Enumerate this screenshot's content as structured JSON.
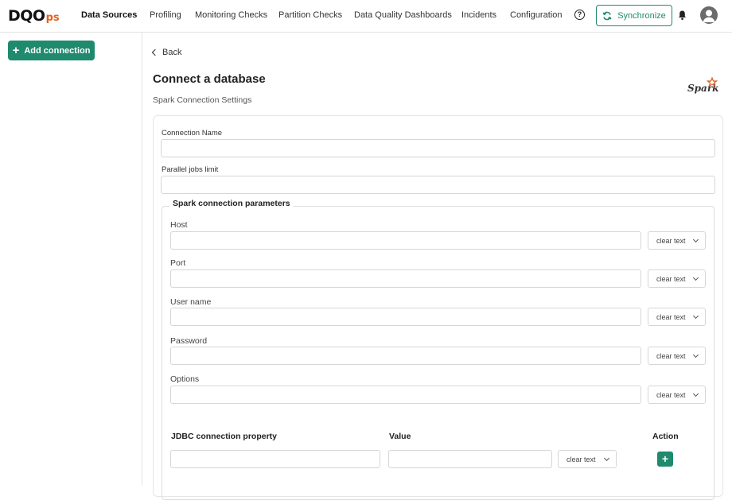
{
  "logo": {
    "main": "DQO",
    "suffix": "ps"
  },
  "nav": {
    "items": [
      "Data Sources",
      "Profiling",
      "Monitoring Checks",
      "Partition Checks",
      "Data Quality Dashboards",
      "Incidents",
      "Configuration"
    ],
    "help": "?",
    "sync_label": "Synchronize"
  },
  "sidebar": {
    "add_connection_label": "Add connection",
    "plus": "+"
  },
  "main": {
    "back_label": "Back",
    "title": "Connect a database",
    "subtitle": "Spark Connection Settings",
    "fields": {
      "connection_name_label": "Connection Name",
      "connection_name_value": "",
      "parallel_jobs_label": "Parallel jobs limit",
      "parallel_jobs_value": ""
    },
    "spark": {
      "legend": "Spark connection parameters",
      "params": [
        {
          "label": "Host",
          "value": "",
          "mode": "clear text"
        },
        {
          "label": "Port",
          "value": "",
          "mode": "clear text"
        },
        {
          "label": "User name",
          "value": "",
          "mode": "clear text"
        },
        {
          "label": "Password",
          "value": "",
          "mode": "clear text"
        },
        {
          "label": "Options",
          "value": "",
          "mode": "clear text"
        }
      ],
      "jdbc": {
        "headers": [
          "JDBC connection property",
          "Value",
          "Action"
        ],
        "row": {
          "property": "",
          "value": "",
          "mode": "clear text"
        },
        "add": "+"
      }
    }
  },
  "colors": {
    "accent": "#1f8a6e",
    "logo_accent": "#e8601c",
    "spark_star": "#e25a1c"
  }
}
